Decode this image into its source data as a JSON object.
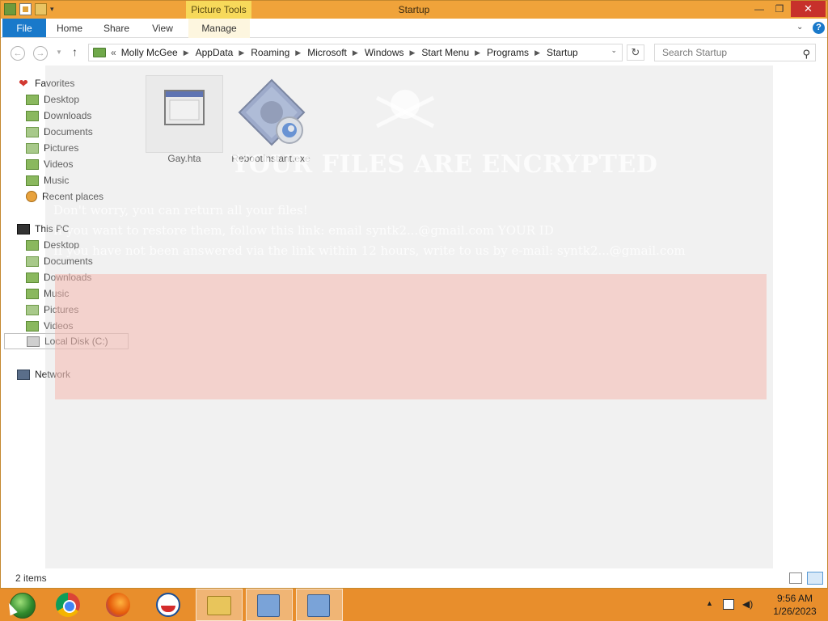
{
  "titlebar": {
    "title": "Startup",
    "context_tab": "Picture Tools",
    "minimize": "—",
    "maximize": "❐",
    "close": "✕"
  },
  "ribbon": {
    "tabs": [
      {
        "label": "File"
      },
      {
        "label": "Home"
      },
      {
        "label": "Share"
      },
      {
        "label": "View"
      },
      {
        "label": "Manage"
      }
    ],
    "expand_icon": "chevron-down-icon",
    "help": "?"
  },
  "navigation": {
    "back": "←",
    "forward": "→",
    "up": "↑",
    "refresh": "↻",
    "breadcrumb_prefix": "«",
    "breadcrumbs": [
      "Molly McGee",
      "AppData",
      "Roaming",
      "Microsoft",
      "Windows",
      "Start Menu",
      "Programs",
      "Startup"
    ],
    "search_placeholder": "Search Startup"
  },
  "navpane": {
    "favorites_label": "Favorites",
    "favorites": [
      "Desktop",
      "Downloads",
      "Documents",
      "Pictures",
      "Videos",
      "Music",
      "Recent places"
    ],
    "thispc_label": "This PC",
    "thispc": [
      "Desktop",
      "Documents",
      "Downloads",
      "Music",
      "Pictures",
      "Videos",
      "Local Disk (C:)"
    ],
    "network_label": "Network"
  },
  "files": [
    {
      "name": "Gay.hta",
      "icon": "hta-window-icon"
    },
    {
      "name": "RebootInstant.exe",
      "icon": "exe-gear-icon"
    }
  ],
  "status": {
    "item_count": "2 items"
  },
  "taskbar": {
    "time": "9:56 AM",
    "date": "1/26/2023"
  },
  "ghost_overlay": {
    "title": "YOUR FILES ARE ENCRYPTED",
    "line1": "Don't worry, you can return all your files!",
    "line2": "If you want to restore them, follow this link: email syntk2...@gmail.com  YOUR ID",
    "line3": "If you have not been answered via the link within 12 hours, write to us by e-mail: syntk2...@gmail.com"
  },
  "colors": {
    "titlebar": "#f0a33a",
    "file_tab": "#1979ca",
    "taskbar": "#e88e2c",
    "close": "#c7302b"
  }
}
